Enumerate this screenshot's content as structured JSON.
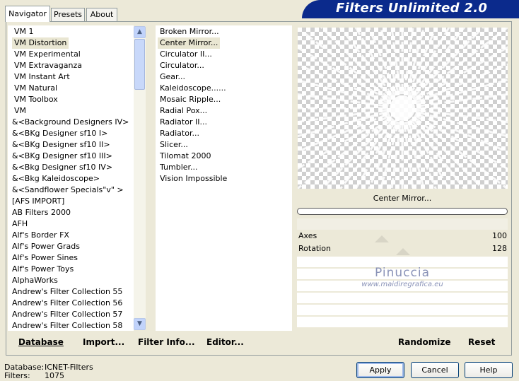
{
  "tabs": [
    "Navigator",
    "Presets",
    "About"
  ],
  "banner_title": "Filters Unlimited 2.0",
  "categories": [
    "VM 1",
    "VM Distortion",
    "VM Experimental",
    "VM Extravaganza",
    "VM Instant Art",
    "VM Natural",
    "VM Toolbox",
    "VM",
    "&<Background Designers IV>",
    "&<BKg Designer sf10 I>",
    "&<BKg Designer sf10 II>",
    "&<BKg Designer sf10 III>",
    "&<Bkg Designer sf10 IV>",
    "&<Bkg Kaleidoscope>",
    "&<Sandflower Specials\"v\" >",
    "[AFS IMPORT]",
    "AB Filters 2000",
    "AFH",
    "Alf's Border FX",
    "Alf's Power Grads",
    "Alf's Power Sines",
    "Alf's Power Toys",
    "AlphaWorks",
    "Andrew's Filter Collection 55",
    "Andrew's Filter Collection 56",
    "Andrew's Filter Collection 57",
    "Andrew's Filter Collection 58"
  ],
  "selected_category": "VM Distortion",
  "filters": [
    "Broken Mirror...",
    "Center Mirror...",
    "Circulator II...",
    "Circulator...",
    "Gear...",
    "Kaleidoscope......",
    "Mosaic Ripple...",
    "Radial Pox...",
    "Radiator II...",
    "Radiator...",
    "Slicer...",
    "Tilomat 2000",
    "Tumbler...",
    "Vision Impossible"
  ],
  "selected_filter": "Center Mirror...",
  "preview_label": "Center Mirror...",
  "params": [
    {
      "name": "Axes",
      "value": "100"
    },
    {
      "name": "Rotation",
      "value": "128"
    }
  ],
  "watermark": {
    "line1": "Pinuccia",
    "line2": "www.maidiregrafica.eu"
  },
  "bottom_buttons": {
    "database": "Database",
    "import": "Import...",
    "filter_info": "Filter Info...",
    "editor": "Editor...",
    "randomize": "Randomize",
    "reset": "Reset"
  },
  "status": {
    "database_label": "Database:",
    "database_value": "ICNET-Filters",
    "filters_label": "Filters:",
    "filters_value": "1075"
  },
  "dialog_buttons": {
    "apply": "Apply",
    "cancel": "Cancel",
    "help": "Help"
  },
  "colors": {
    "banner": "#0B2A8C",
    "selected_row": "#E9E6D2",
    "window_bg": "#ECE9D8"
  }
}
